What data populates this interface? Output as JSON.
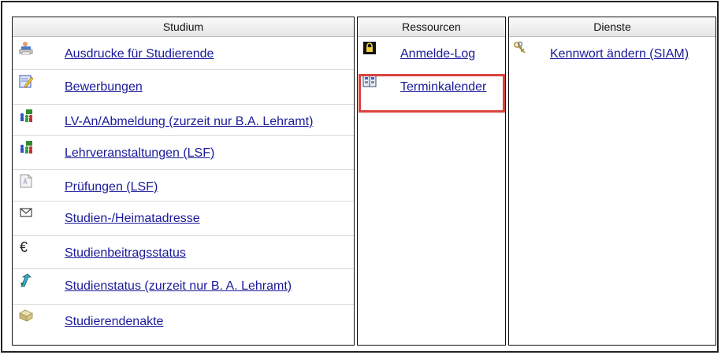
{
  "studium": {
    "header": "Studium",
    "items": [
      {
        "label": "Ausdrucke für Studierende",
        "icon": "printer-icon"
      },
      {
        "label": "Bewerbungen",
        "icon": "edit-form-icon"
      },
      {
        "label": "LV-An/Abmeldung (zurzeit nur B.A. Lehramt)",
        "icon": "group-icon"
      },
      {
        "label": "Lehrveranstaltungen (LSF)",
        "icon": "group-icon"
      },
      {
        "label": "Prüfungen (LSF)",
        "icon": "exam-document-icon"
      },
      {
        "label": "Studien-/Heimatadresse",
        "icon": "envelope-icon"
      },
      {
        "label": "Studienbeitragsstatus",
        "icon": "euro-icon"
      },
      {
        "label": "Studienstatus (zurzeit nur B. A. Lehramt)",
        "icon": "status-arrow-icon"
      },
      {
        "label": "Studierendenakte",
        "icon": "file-folder-icon"
      }
    ]
  },
  "ressourcen": {
    "header": "Ressourcen",
    "items": [
      {
        "label": "Anmelde-Log",
        "icon": "lock-icon"
      },
      {
        "label": "Terminkalender",
        "icon": "calendar-icon",
        "highlighted": true
      }
    ]
  },
  "dienste": {
    "header": "Dienste",
    "items": [
      {
        "label": "Kennwort ändern (SIAM)",
        "icon": "keys-icon"
      }
    ]
  },
  "colors": {
    "link": "#1a1a9a",
    "highlight": "#d9443f",
    "header_bg": "#eeeeee",
    "border": "#111111"
  }
}
